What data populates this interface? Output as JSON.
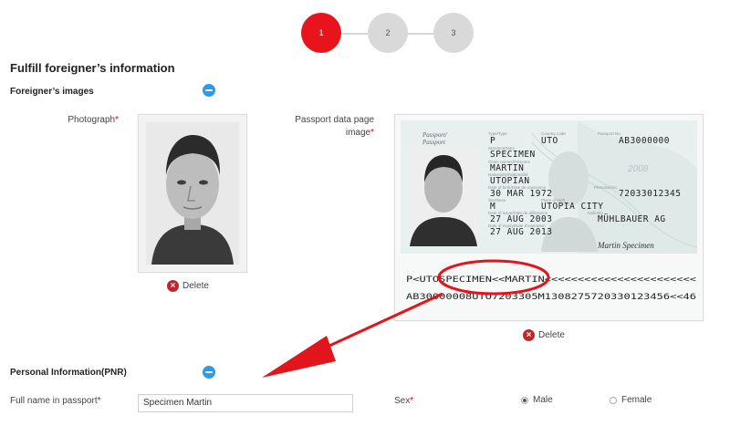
{
  "stepper": {
    "steps": [
      "1",
      "2",
      "3"
    ],
    "active": 1
  },
  "page_title": "Fulfill foreigner’s information",
  "images_section": {
    "title": "Foreigner’s images",
    "photograph_label": "Photograph",
    "passport_label_1": "Passport data page",
    "passport_label_2": "image",
    "required_mark": "*",
    "delete_label": "Delete"
  },
  "passport": {
    "doc_label": "Passport/\nPassport",
    "type": "P",
    "country": "UTO",
    "number": "AB3000000",
    "surname": "SPECIMEN",
    "given_names": "MARTIN",
    "nationality": "UTOPIAN",
    "date_of_birth": "30 MAR 1972",
    "personal_no": "72033012345",
    "sex": "M",
    "place_of_birth": "UTOPIA CITY",
    "date_of_issue": "27 AUG 2003",
    "authority": "MÜHLBAUER AG",
    "date_of_expiry": "27 AUG 2013",
    "signature": "Martin Specimen",
    "watermark_year": "2008",
    "mrz_line1": "P<UTOSPECIMEN<<MARTIN<<<<<<<<<<<<<<<<<<<<<<<",
    "mrz_line2": "AB30000008UTO7203305M1308275720330123456<<46"
  },
  "pnr_section": {
    "title": "Personal Information(PNR)",
    "full_name_label": "Full name in passport",
    "full_name_value": "Specimen Martin",
    "sex_label": "Sex",
    "sex_options": [
      "Male",
      "Female"
    ],
    "sex_selected": "Male"
  },
  "colors": {
    "accent": "#e8141c",
    "info_blue": "#2f9be8",
    "delete_red": "#c0262c"
  }
}
